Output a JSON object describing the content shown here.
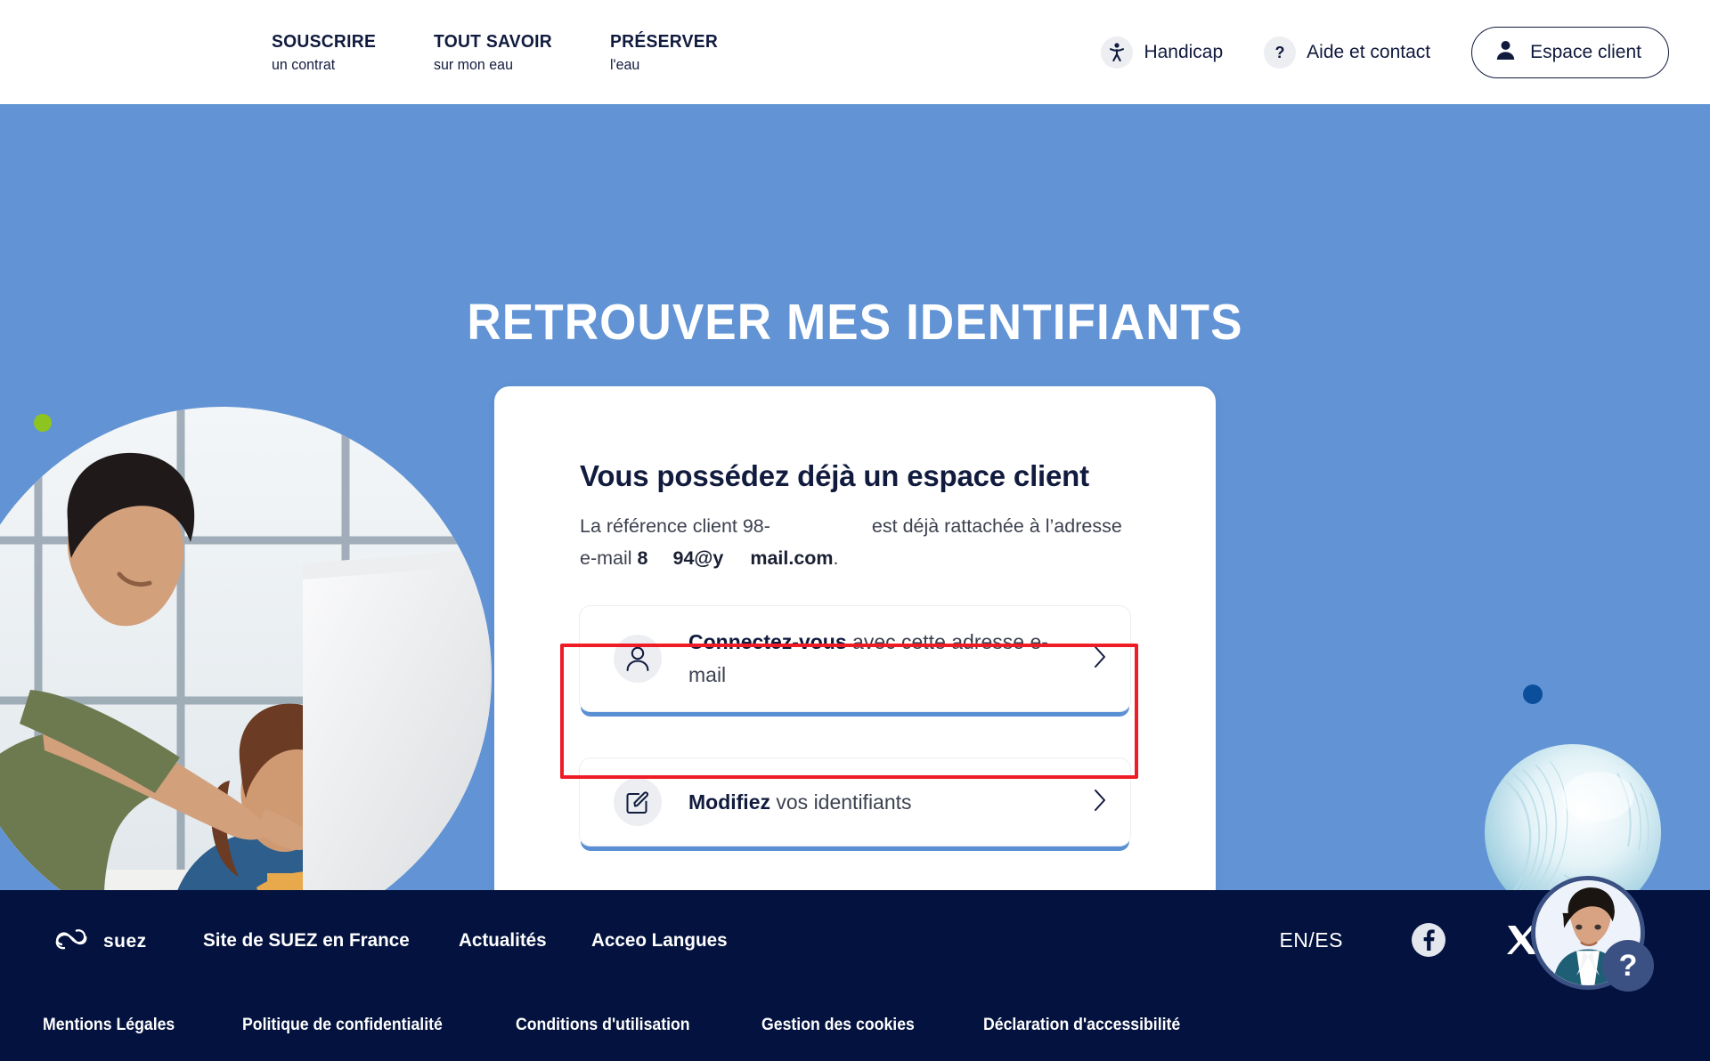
{
  "header": {
    "nav": [
      {
        "top": "SOUSCRIRE",
        "sub": "un contrat"
      },
      {
        "top": "TOUT SAVOIR",
        "sub": "sur mon eau"
      },
      {
        "top": "PRÉSERVER",
        "sub": "l'eau"
      }
    ],
    "handicap_label": "Handicap",
    "help_label": "Aide et contact",
    "account_label": "Espace client"
  },
  "hero": {
    "title": "RETROUVER MES IDENTIFIANTS",
    "background_color": "#6193d5"
  },
  "card": {
    "title": "Vous possédez déjà un espace client",
    "paragraph": {
      "part1": "La référence client 98-",
      "redacted1": "",
      "part2": " est déjà rattachée à l’adresse e-mail ",
      "email_b1": "8",
      "email_b2": "94",
      "email_b3": "@y",
      "email_b4": "mail.com",
      "end": "."
    },
    "options": [
      {
        "icon": "user-icon",
        "strong": "Connectez-vous",
        "rest": " avec cette adresse e-mail",
        "chevron": "chevron-right-icon"
      },
      {
        "icon": "edit-pencil-icon",
        "strong": "Modifiez",
        "rest": " vos identifiants",
        "chevron": "chevron-right-icon"
      }
    ]
  },
  "annotation": {
    "color": "#ef1c26",
    "target": "Modifiez vos identifiants"
  },
  "footer": {
    "logo_text": "suez",
    "top_links": [
      "Site de SUEZ en France",
      "Actualités",
      "Acceo Langues"
    ],
    "language": "EN/ES",
    "social": [
      {
        "name": "facebook-icon"
      },
      {
        "name": "x-twitter-icon"
      }
    ],
    "bottom_links": [
      "Mentions Légales",
      "Politique de confidentialité",
      "Conditions d'utilisation",
      "Gestion des cookies",
      "Déclaration d'accessibilité"
    ],
    "background_color": "#03123e"
  },
  "chatbot": {
    "badge": "?"
  },
  "decor": {
    "green_dot_color": "#8ec420",
    "blue_dot_color": "#0b4f9c"
  }
}
